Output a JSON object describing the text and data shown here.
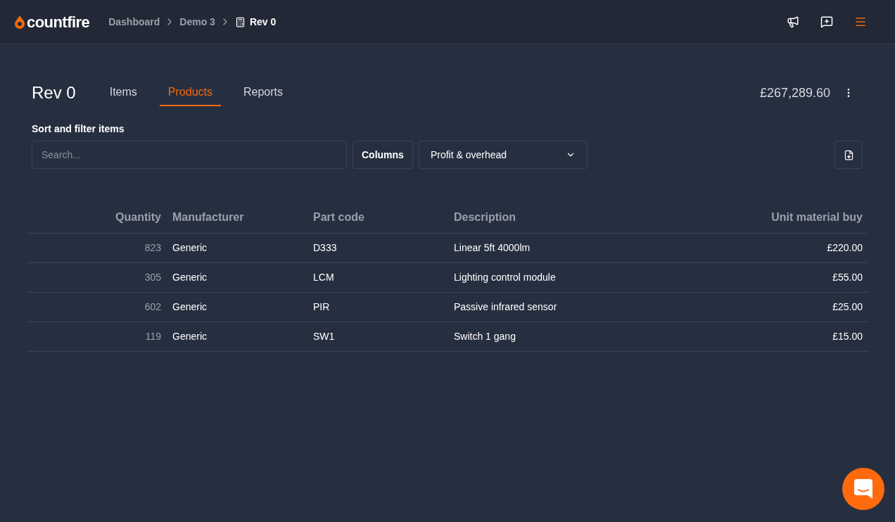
{
  "header": {
    "logo": "countfire",
    "breadcrumbs": [
      {
        "label": "Dashboard",
        "current": false
      },
      {
        "label": "Demo 3",
        "current": false
      },
      {
        "label": "Rev 0",
        "current": true
      }
    ]
  },
  "page": {
    "title": "Rev 0",
    "total": "£267,289.60"
  },
  "tabs": [
    {
      "label": "Items",
      "selected": false
    },
    {
      "label": "Products",
      "selected": true
    },
    {
      "label": "Reports",
      "selected": false
    }
  ],
  "filter": {
    "label": "Sort and filter items",
    "search": {
      "placeholder": "Search..."
    },
    "columns_button": "Columns",
    "view_select": "Profit & overhead"
  },
  "table": {
    "columns": [
      "Quantity",
      "Manufacturer",
      "Part code",
      "Description",
      "Unit material buy"
    ],
    "rows": [
      [
        "823",
        "Generic",
        "D333",
        "Linear 5ft 4000lm",
        "£220.00"
      ],
      [
        "305",
        "Generic",
        "LCM",
        "Lighting control module",
        "£55.00"
      ],
      [
        "602",
        "Generic",
        "PIR",
        "Passive infrared sensor",
        "£25.00"
      ],
      [
        "119",
        "Generic",
        "SW1",
        "Switch 1 gang",
        "£15.00"
      ]
    ]
  }
}
